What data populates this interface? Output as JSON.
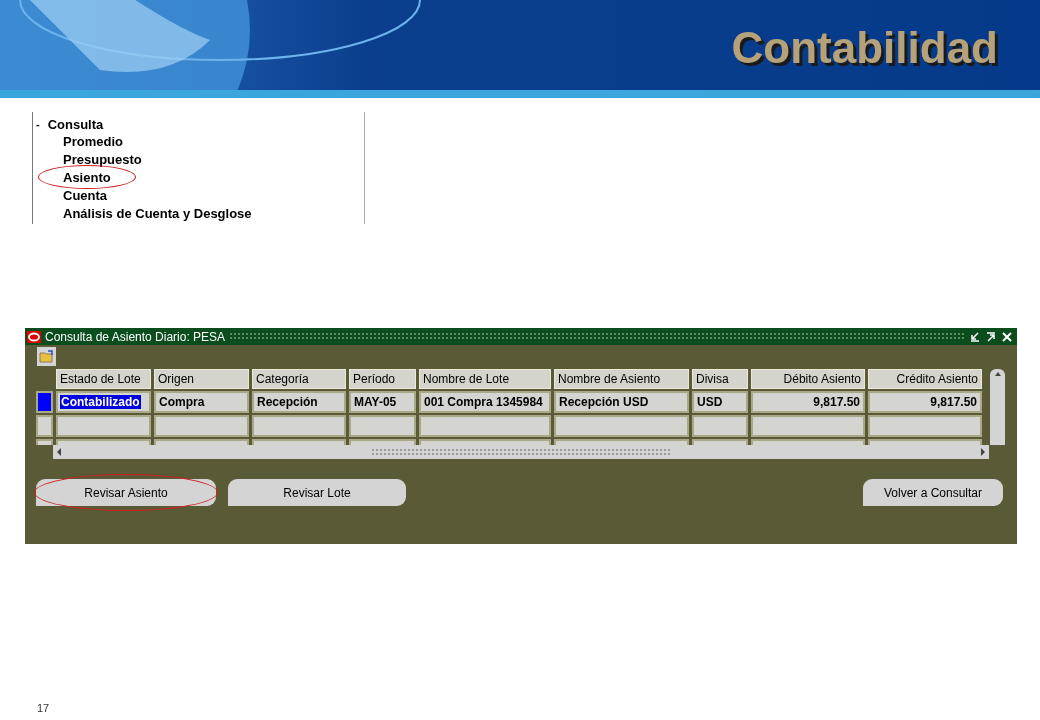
{
  "header": {
    "title": "Contabilidad"
  },
  "tree": {
    "label": "Consulta",
    "toggle": "-",
    "expanded": true,
    "children": [
      {
        "label": "Promedio",
        "highlighted": false
      },
      {
        "label": "Presupuesto",
        "highlighted": false
      },
      {
        "label": "Asiento",
        "highlighted": true
      },
      {
        "label": "Cuenta",
        "highlighted": false
      },
      {
        "label": "Análisis de Cuenta y Desglose",
        "highlighted": false
      }
    ]
  },
  "window": {
    "title": "Consulta de Asiento Diario: PESA",
    "table": {
      "columns": [
        {
          "label": "Estado de Lote",
          "kind": "text"
        },
        {
          "label": "Origen",
          "kind": "text"
        },
        {
          "label": "Categoría",
          "kind": "text"
        },
        {
          "label": "Período",
          "kind": "text"
        },
        {
          "label": "Nombre de Lote",
          "kind": "text"
        },
        {
          "label": "Nombre de Asiento",
          "kind": "text"
        },
        {
          "label": "Divisa",
          "kind": "text"
        },
        {
          "label": "Débito Asiento",
          "kind": "amount"
        },
        {
          "label": "Crédito Asiento",
          "kind": "amount"
        }
      ],
      "rows": [
        {
          "selected": true,
          "cells": [
            "Contabilizado",
            "Compra",
            "Recepción",
            "MAY-05",
            "001 Compra 1345984",
            "Recepción USD",
            "USD",
            "9,817.50",
            "9,817.50"
          ]
        }
      ]
    },
    "buttons": [
      {
        "label": "Revisar Asiento",
        "highlighted": true
      },
      {
        "label": "Revisar Lote",
        "highlighted": false
      },
      {
        "label": "Volver a Consultar",
        "highlighted": false
      }
    ]
  },
  "page_number": "17"
}
